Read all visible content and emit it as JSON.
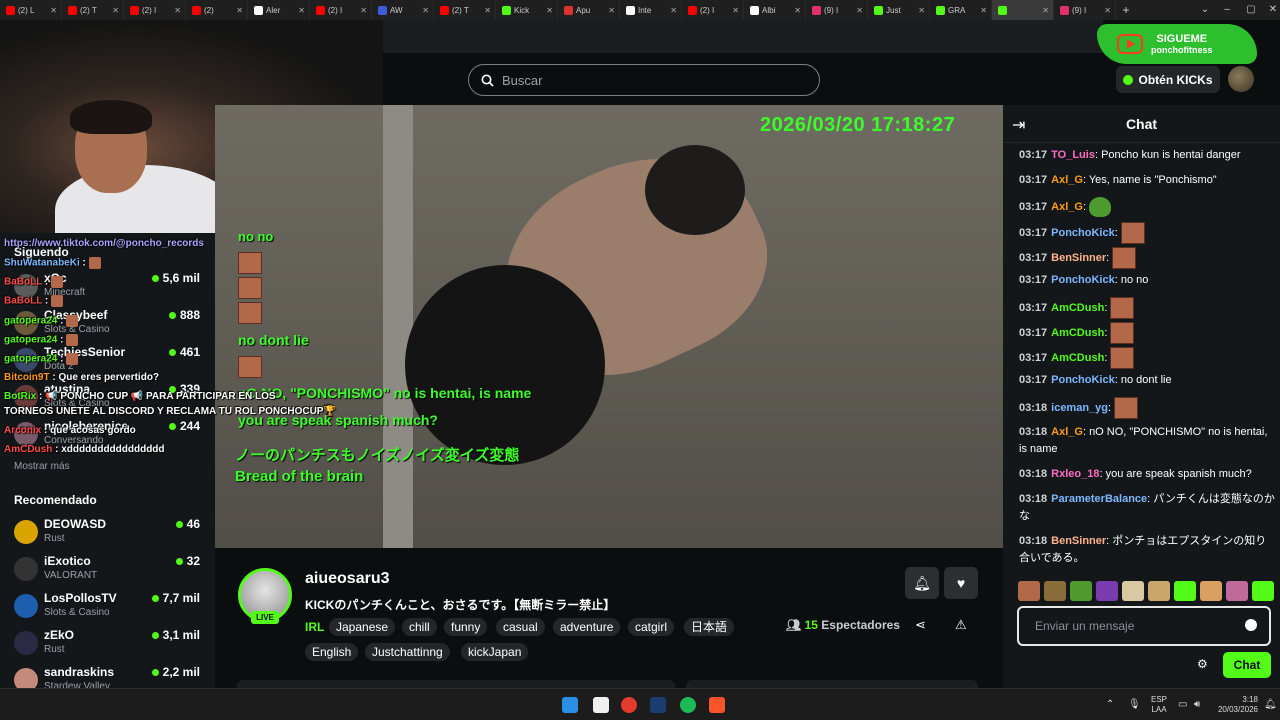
{
  "browser": {
    "tabs": [
      {
        "label": "(2) L",
        "color": "#ff0000"
      },
      {
        "label": "(2) T",
        "color": "#ff0000"
      },
      {
        "label": "(2) I",
        "color": "#ff0000"
      },
      {
        "label": "(2) ",
        "color": "#ff0000"
      },
      {
        "label": "Aler",
        "color": "#ffffff"
      },
      {
        "label": "(2) I",
        "color": "#ff0000"
      },
      {
        "label": "AW",
        "color": "#3b5bdb"
      },
      {
        "label": "(2) T",
        "color": "#ff0000"
      },
      {
        "label": "Kick",
        "color": "#53fc18"
      },
      {
        "label": "Apu",
        "color": "#e03131"
      },
      {
        "label": "Inte",
        "color": "#ffffff"
      },
      {
        "label": "(2) I",
        "color": "#ff0000"
      },
      {
        "label": "Albi",
        "color": "#ffffff"
      },
      {
        "label": "(9) I",
        "color": "#e1306c"
      },
      {
        "label": "Just",
        "color": "#53fc18"
      },
      {
        "label": "GRA",
        "color": "#53fc18"
      },
      {
        "label": "",
        "color": "#53fc18"
      },
      {
        "label": "(9) I",
        "color": "#e1306c"
      }
    ],
    "new_tab": "+"
  },
  "header": {
    "search_placeholder": "Buscar",
    "kicks_button": "Obtén KICKs",
    "promo_title": "SIGUEME",
    "promo_handle": "ponchofitness"
  },
  "sidebar": {
    "following_heading": "Siguendo",
    "following": [
      {
        "name": "xQc",
        "game": "Minecraft",
        "viewers": "5,6 mil",
        "color": "#5b5b5b"
      },
      {
        "name": "Classybeef",
        "game": "Slots & Casino",
        "viewers": "888",
        "color": "#6a5a3a"
      },
      {
        "name": "TechiesSenior",
        "game": "Dota 2",
        "viewers": "461",
        "color": "#3a4a6a"
      },
      {
        "name": "atustina",
        "game": "Slots & Casino",
        "viewers": "339",
        "color": "#6a3a3a"
      },
      {
        "name": "nicoleberenice",
        "game": "Conversando",
        "viewers": "244",
        "color": "#7a5a6a"
      }
    ],
    "show_more": "Mostrar más",
    "recommended_heading": "Recomendado",
    "recommended": [
      {
        "name": "DEOWASD",
        "game": "Rust",
        "viewers": "46",
        "color": "#d9a400"
      },
      {
        "name": "iExotico",
        "game": "VALORANT",
        "viewers": "32",
        "color": "#333333"
      },
      {
        "name": "LosPollosTV",
        "game": "Slots & Casino",
        "viewers": "7,7 mil",
        "color": "#1e5fb0"
      },
      {
        "name": "zEkO",
        "game": "Rust",
        "viewers": "3,1 mil",
        "color": "#2a2a44"
      },
      {
        "name": "sandraskins",
        "game": "Stardew Valley",
        "viewers": "2,2 mil",
        "color": "#c48a7a"
      }
    ]
  },
  "overlay_chat": [
    {
      "text": "https://www.tiktok.com/@poncho_records",
      "color": "#a9a3ff"
    },
    {
      "user": "ShuWatanabeKi",
      "text": " :",
      "color": "#7ab8ff"
    },
    {
      "user": "BaBoLL",
      "text": " :",
      "color": "#ff4a4a"
    },
    {
      "user": "BaBoLL",
      "text": " :",
      "color": "#ff4a4a"
    },
    {
      "user": "gatopera24",
      "text": " :",
      "color": "#53fc18"
    },
    {
      "user": "gatopera24",
      "text": " :",
      "color": "#53fc18"
    },
    {
      "user": "gatopera24",
      "text": " :",
      "color": "#53fc18"
    },
    {
      "user": "Bitcoin9T",
      "text": " : Que eres pervertido?",
      "color": "#ff9b1a"
    },
    {
      "user": "BotRix",
      "text": " : 📢 PONCHO CUP 📢 PARA PARTICIPAR EN LOS",
      "color": "#53fc18"
    },
    {
      "user": "",
      "text": "TORNEOS UNETE AL DISCORD Y RECLAMA TU ROL PONCHOCUP🏆",
      "color": "#ffffff"
    },
    {
      "user": "Arconix",
      "text": " : que acosas gordo",
      "color": "#ff4a4a"
    },
    {
      "user": "AmCDush",
      "text": " : xdddddddddddddddd",
      "color": "#ff4a4a"
    }
  ],
  "video": {
    "timestamp": "2026/03/20 17:18:27",
    "overlay_lines": [
      "no no",
      "no dont lie",
      "nO NO, \"PONCHISMO\" no is hentai, is name",
      "you are speak spanish much?",
      "ノーのパンチスもノイズノイズ変イズ変態",
      "Bread of the brain"
    ]
  },
  "stream": {
    "streamer": "aiueosaru3",
    "title": "KICKのパンチくんこと、おさるです。【無断ミラー禁止】",
    "category": "IRL",
    "live_label": "LIVE",
    "tags": [
      "Japanese",
      "chill",
      "funny",
      "casual",
      "adventure",
      "catgirl",
      "日本語",
      "English",
      "Justchattinng",
      "kickJapan"
    ],
    "viewer_count": "15",
    "viewer_label": "Espectadores"
  },
  "chat": {
    "title": "Chat",
    "messages": [
      {
        "time": "03:17",
        "user": "TO_Luis",
        "color": "#ff6bc1",
        "text": "Poncho kun is hentai danger",
        "emotes": 0
      },
      {
        "time": "03:17",
        "user": "Axl_G",
        "color": "#ff9b1a",
        "text": "Yes, name is \"Ponchismo\"",
        "emotes": 0
      },
      {
        "time": "03:17",
        "user": "Axl_G",
        "color": "#ff9b1a",
        "text": "",
        "emotes": 1,
        "peepo": true
      },
      {
        "time": "03:17",
        "user": "PonchoKick",
        "color": "#7ab8ff",
        "text": "",
        "emotes": 1
      },
      {
        "time": "03:17",
        "user": "BenSinner",
        "color": "#ffb38a",
        "text": "",
        "emotes": 1
      },
      {
        "time": "03:17",
        "user": "PonchoKick",
        "color": "#7ab8ff",
        "text": "no no",
        "emotes": 0
      },
      {
        "time": "03:17",
        "user": "AmCDush",
        "color": "#53fc18",
        "text": "",
        "emotes": 1
      },
      {
        "time": "03:17",
        "user": "AmCDush",
        "color": "#53fc18",
        "text": "",
        "emotes": 1
      },
      {
        "time": "03:17",
        "user": "AmCDush",
        "color": "#53fc18",
        "text": "",
        "emotes": 1
      },
      {
        "time": "03:17",
        "user": "PonchoKick",
        "color": "#7ab8ff",
        "text": "no dont lie",
        "emotes": 0
      },
      {
        "time": "03:18",
        "user": "iceman_yg",
        "color": "#7ab8ff",
        "text": "",
        "emotes": 1
      },
      {
        "time": "03:18",
        "user": "Axl_G",
        "color": "#ff9b1a",
        "text": "nO NO, \"PONCHISMO\" no is hentai, is name",
        "emotes": 0
      },
      {
        "time": "03:18",
        "user": "Rxleo_18",
        "color": "#ff6bc1",
        "text": "you are speak spanish much?",
        "emotes": 0
      },
      {
        "time": "03:18",
        "user": "ParameterBalance",
        "color": "#7ab8ff",
        "text": "パンチくんは変態なのかな",
        "emotes": 0
      },
      {
        "time": "03:18",
        "user": "BenSinner",
        "color": "#ffb38a",
        "text": "ポンチョはエプスタインの知り合いである。",
        "emotes": 0
      }
    ],
    "input_placeholder": "Enviar un mensaje",
    "send_label": "Chat"
  },
  "taskbar": {
    "lang_line1": "ESP",
    "lang_line2": "LAA",
    "time": "3:18",
    "date": "20/03/2026"
  },
  "colors": {
    "accent": "#53fc18",
    "background": "#0b0e0f",
    "panel": "#14171a"
  }
}
